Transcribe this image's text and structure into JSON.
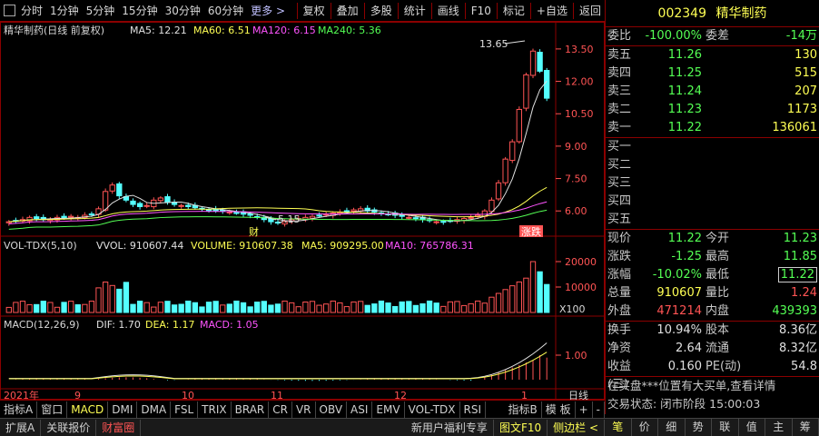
{
  "toolbar": {
    "periods": [
      "分时",
      "1分钟",
      "5分钟",
      "15分钟",
      "30分钟",
      "60分钟"
    ],
    "more": "更多 >",
    "actions": [
      "复权",
      "叠加",
      "多股",
      "统计",
      "画线",
      "F10",
      "标记",
      "+自选",
      "返回"
    ]
  },
  "kline": {
    "title": "精华制药(日线 前复权)",
    "ma5": "MA5: 12.21",
    "ma60": "MA60: 6.51",
    "ma120": "MA120: 6.15",
    "ma240": "MA240: 5.36",
    "high_label": "13.65",
    "low_label": "5.15",
    "y_ticks": [
      "13.50",
      "12.00",
      "10.50",
      "9.00",
      "7.50",
      "6.00"
    ],
    "markers": [
      "财",
      "涨跌"
    ]
  },
  "volume": {
    "title": "VOL-TDX(5,10)",
    "vvol": "VVOL: 910607.44",
    "volume": "VOLUME: 910607.38",
    "ma5": "MA5: 909295.00",
    "ma10": "MA10: 765786.31",
    "y_ticks": [
      "20000",
      "10000"
    ],
    "unit": "X100"
  },
  "macd": {
    "title": "MACD(12,26,9)",
    "dif": "DIF: 1.70",
    "dea": "DEA: 1.17",
    "macd": "MACD: 1.05",
    "y_ticks": [
      "1.00"
    ]
  },
  "xaxis": {
    "labels": [
      "2021年",
      "9",
      "10",
      "11",
      "12",
      "1"
    ],
    "period": "日线"
  },
  "indicator_tabs": {
    "left_label": "指标A",
    "items": [
      "窗口",
      "MACD",
      "DMI",
      "DMA",
      "FSL",
      "TRIX",
      "BRAR",
      "CR",
      "VR",
      "OBV",
      "ASI",
      "EMV",
      "VOL-TDX",
      "RSI"
    ],
    "right_label": "指标B",
    "template": "模 板",
    "plus": "+",
    "minus": "-"
  },
  "quote": {
    "code": "002349",
    "name": "精华制药",
    "weibi_label": "委比",
    "weibi": "-100.00%",
    "weicha_label": "委差",
    "weicha": "-14万",
    "asks": [
      {
        "label": "卖五",
        "price": "11.26",
        "vol": "130"
      },
      {
        "label": "卖四",
        "price": "11.25",
        "vol": "515"
      },
      {
        "label": "卖三",
        "price": "11.24",
        "vol": "207"
      },
      {
        "label": "卖二",
        "price": "11.23",
        "vol": "1173"
      },
      {
        "label": "卖一",
        "price": "11.22",
        "vol": "136061"
      }
    ],
    "bids": [
      {
        "label": "买一"
      },
      {
        "label": "买二"
      },
      {
        "label": "买三"
      },
      {
        "label": "买四"
      },
      {
        "label": "买五"
      }
    ],
    "stats": [
      {
        "l1": "现价",
        "v1": "11.22",
        "c1": "g",
        "l2": "今开",
        "v2": "11.23",
        "c2": "g"
      },
      {
        "l1": "涨跌",
        "v1": "-1.25",
        "c1": "g",
        "l2": "最高",
        "v2": "11.85",
        "c2": "g"
      },
      {
        "l1": "涨幅",
        "v1": "-10.02%",
        "c1": "g",
        "l2": "最低",
        "v2": "11.22",
        "c2": "g"
      },
      {
        "l1": "总量",
        "v1": "910607",
        "c1": "y",
        "l2": "量比",
        "v2": "1.24",
        "c2": "r"
      },
      {
        "l1": "外盘",
        "v1": "471214",
        "c1": "r",
        "l2": "内盘",
        "v2": "439393",
        "c2": "g"
      }
    ],
    "stats2": [
      {
        "l1": "换手",
        "v1": "10.94%",
        "l2": "股本",
        "v2": "8.36亿"
      },
      {
        "l1": "净资",
        "v1": "2.64",
        "l2": "流通",
        "v2": "8.32亿"
      },
      {
        "l1": "收益(三)",
        "v1": "0.160",
        "l2": "PE(动)",
        "v2": "54.8"
      }
    ],
    "notice": "在买盘***位置有大买单,查看详情",
    "trade_state": "交易状态: 闭市阶段 15:00:03"
  },
  "statusbar": {
    "items": [
      "扩展A",
      "关联报价",
      "财富圈"
    ],
    "right_items": [
      "新用户福利专享",
      "图文F10",
      "侧边栏 <"
    ]
  },
  "right_tabs": [
    "笔",
    "价",
    "细",
    "势",
    "联",
    "值",
    "主",
    "筹"
  ],
  "colors": {
    "up": "#ff5454",
    "down": "#54ffff",
    "border": "#8b0000",
    "yellow": "#ffff54",
    "green": "#54ff54"
  },
  "chart_data": {
    "type": "candlestick",
    "title": "精华制药(日线 前复权)",
    "ylim": [
      5.0,
      14.0
    ],
    "x_month_labels": [
      "9",
      "10",
      "11",
      "12",
      "1"
    ],
    "close_series": [
      5.5,
      5.55,
      5.6,
      5.7,
      5.65,
      5.6,
      5.62,
      5.7,
      5.68,
      5.75,
      5.7,
      5.8,
      5.85,
      6.1,
      6.9,
      7.2,
      6.7,
      6.5,
      6.3,
      6.2,
      6.25,
      6.5,
      6.6,
      6.4,
      6.3,
      6.25,
      6.2,
      6.15,
      6.1,
      6.05,
      6.0,
      6.0,
      5.95,
      5.9,
      5.85,
      5.8,
      5.7,
      5.6,
      5.5,
      5.45,
      5.5,
      5.6,
      5.65,
      5.7,
      5.75,
      5.8,
      5.85,
      5.9,
      5.95,
      6.0,
      6.05,
      6.1,
      6.0,
      5.95,
      5.9,
      5.85,
      5.8,
      5.75,
      5.7,
      5.65,
      5.6,
      5.55,
      5.5,
      5.5,
      5.55,
      5.6,
      5.65,
      5.7,
      5.8,
      6.0,
      6.5,
      7.3,
      8.4,
      9.2,
      10.7,
      12.3,
      13.4,
      12.47,
      11.22
    ],
    "ma_values": {
      "MA5": 12.21,
      "MA60": 6.51,
      "MA120": 6.15,
      "MA240": 5.36
    }
  }
}
